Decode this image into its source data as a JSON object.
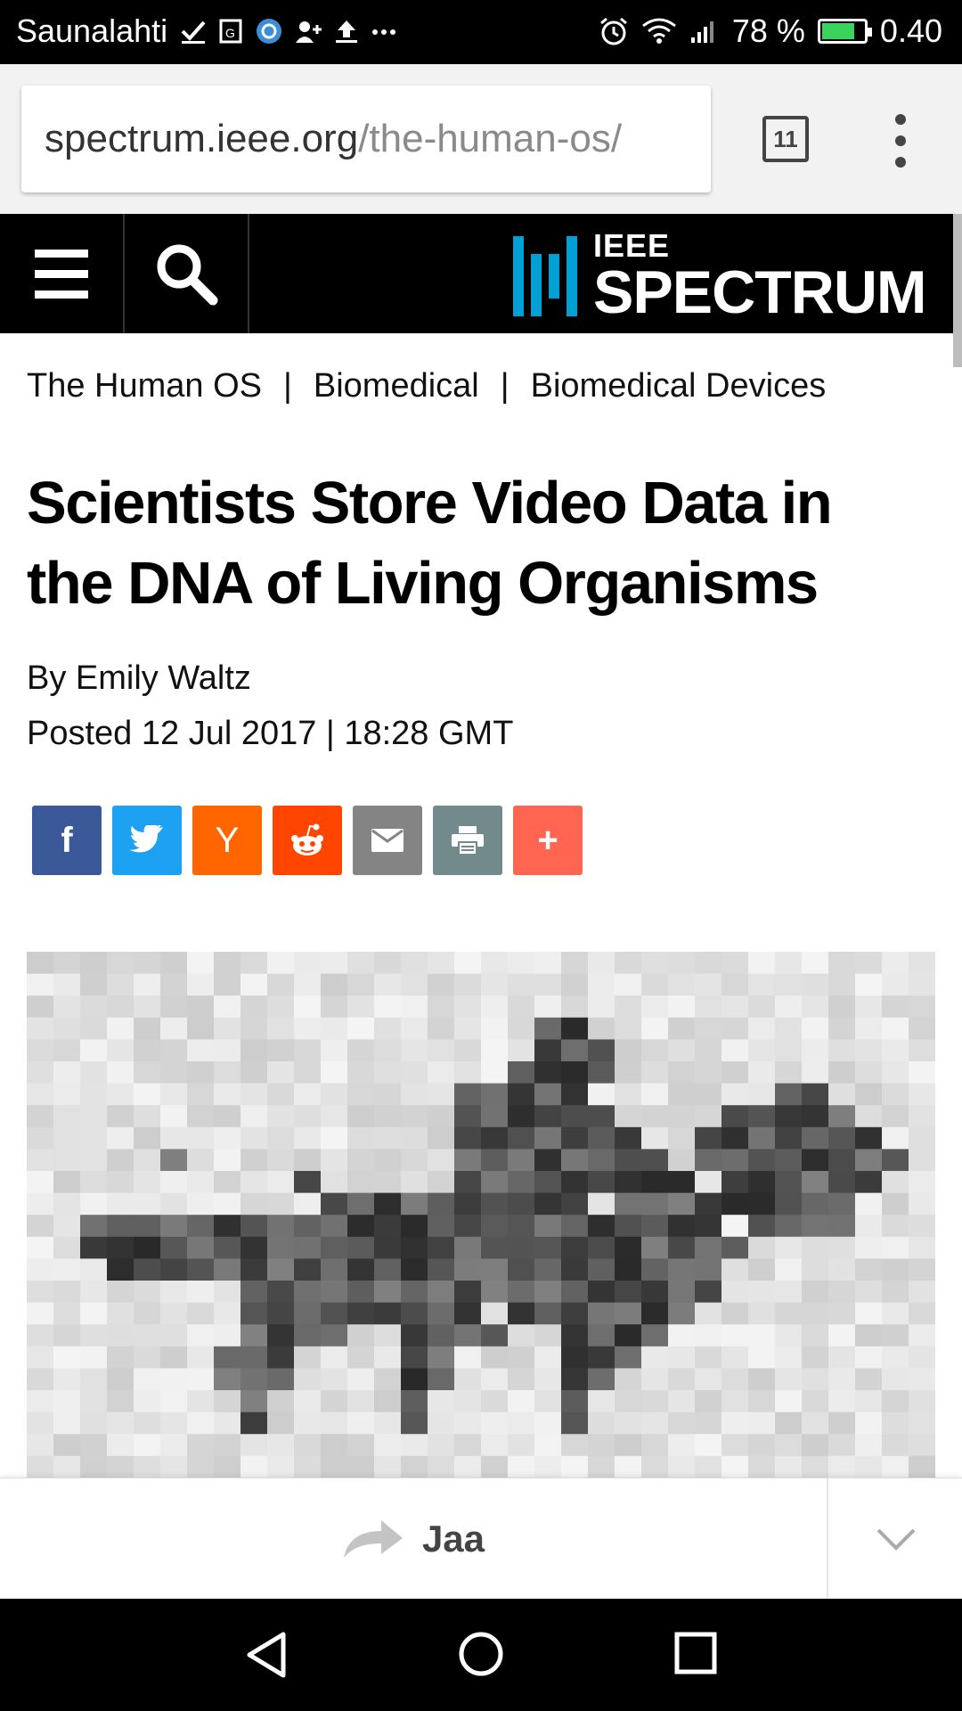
{
  "status_bar": {
    "carrier": "Saunalahti",
    "notification_icons": [
      "check-icon",
      "sim-icon",
      "circle-app-icon",
      "add-contact-icon",
      "upload-icon",
      "more-icon"
    ],
    "battery_percent": "78 %",
    "battery_level": 0.78,
    "time": "0.40"
  },
  "browser": {
    "url_host": "spectrum.ieee.org",
    "url_path": "/the-human-os/",
    "tab_count": "11"
  },
  "site": {
    "logo_top": "IEEE",
    "logo_main": "SPECTRUM",
    "brand_color": "#00a0d6"
  },
  "article": {
    "breadcrumb": [
      "The Human OS",
      "Biomedical",
      "Biomedical Devices"
    ],
    "breadcrumb_separator": "|",
    "title": "Scientists Store Video Data in the DNA of Living Organisms",
    "byline": "By Emily Waltz",
    "posted": "Posted 12 Jul 2017 | 18:28 GMT"
  },
  "share_buttons": [
    {
      "name": "facebook",
      "glyph": "f",
      "color": "#3b5998"
    },
    {
      "name": "twitter",
      "glyph": "",
      "color": "#1da1f2"
    },
    {
      "name": "hacker-news",
      "glyph": "Y",
      "color": "#ff6600"
    },
    {
      "name": "reddit",
      "glyph": "",
      "color": "#ff4500"
    },
    {
      "name": "email",
      "glyph": "",
      "color": "#848484"
    },
    {
      "name": "print",
      "glyph": "",
      "color": "#738a8d"
    },
    {
      "name": "more",
      "glyph": "+",
      "color": "#ff6550"
    }
  ],
  "bottom_bar": {
    "share_label": "Jaa"
  }
}
